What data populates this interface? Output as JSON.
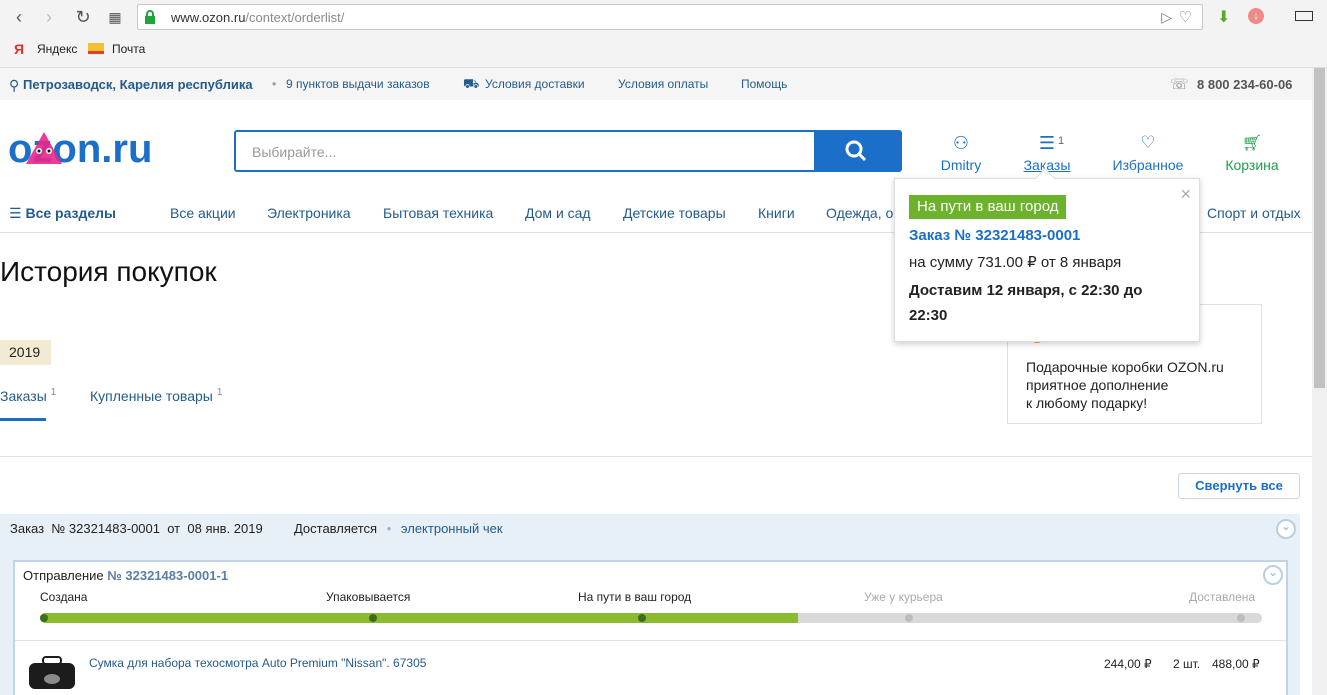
{
  "browser": {
    "url_host": "www.ozon.ru",
    "url_path": "/context/orderlist/",
    "bookmarks": [
      "Яндекс",
      "Почта"
    ]
  },
  "topbar": {
    "city": "Петрозаводск, Карелия республика",
    "pickup": "9 пунктов выдачи заказов",
    "delivery": "Условия доставки",
    "payment": "Условия оплаты",
    "help": "Помощь",
    "phone": "8 800 234-60-06"
  },
  "header": {
    "logo": "OZON.ru",
    "search_placeholder": "Выбирайте...",
    "user": "Dmitry",
    "orders": "Заказы",
    "orders_count": "1",
    "favorites": "Избранное",
    "cart": "Корзина"
  },
  "menu": {
    "all": "Все разделы",
    "items": [
      "Все акции",
      "Электроника",
      "Бытовая техника",
      "Дом и сад",
      "Детские товары",
      "Книги",
      "Одежда, о",
      "Спорт и отдых"
    ]
  },
  "page": {
    "title": "История покупок",
    "year": "2019",
    "tab_orders": "Заказы",
    "tab_orders_count": "1",
    "tab_bought": "Купленные товары",
    "tab_bought_count": "1",
    "collapse_all": "Свернуть все"
  },
  "promo": {
    "line1": "Подарочные коробки OZON.ru",
    "line2": "приятное дополнение",
    "line3": "к любому подарку!"
  },
  "order": {
    "label": "Заказ",
    "number": "№ 32321483-0001",
    "date_prefix": "от",
    "date": "08 янв. 2019",
    "status": "Доставляется",
    "receipt": "электронный чек",
    "shipment_label": "Отправление",
    "shipment_number": "№ 32321483-0001-1",
    "stages": [
      "Создана",
      "Упаковывается",
      "На пути в ваш город",
      "Уже у курьера",
      "Доставлена"
    ],
    "progress": 0.62,
    "product_name": "Сумка для набора техосмотра Auto Premium \"Nissan\". 67305",
    "unit_price": "244,00 ₽",
    "qty": "2 шт.",
    "total": "488,00 ₽"
  },
  "popup": {
    "badge": "На пути в ваш город",
    "order": "Заказ № 32321483-0001",
    "sum": "на сумму 731.00 ₽ от 8 января",
    "delivery": "Доставим 12 января, с 22:30 до 22:30"
  },
  "colors": {
    "brand_blue": "#1b6fc8",
    "progress_green": "#8dbb30",
    "badge_green": "#6cb22a"
  }
}
